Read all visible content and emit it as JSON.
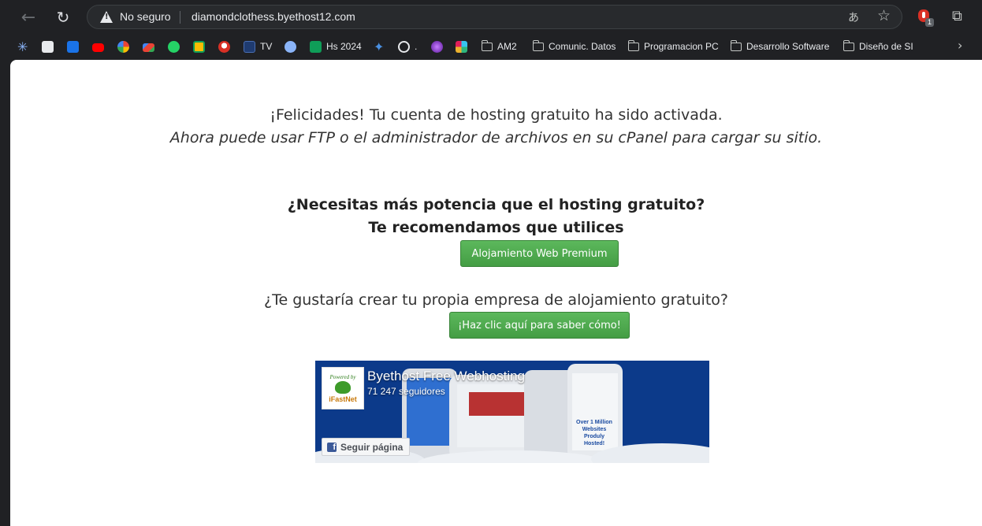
{
  "browser": {
    "security_label": "No seguro",
    "url": "diamondclothess.byethost12.com",
    "extension_badge": "1"
  },
  "bookmarks": [
    {
      "label": "",
      "icon": "asterisk-icon",
      "color": "#8ab4f8"
    },
    {
      "label": "",
      "icon": "document-icon",
      "color": "#e8eaed"
    },
    {
      "label": "",
      "icon": "google-classroom-icon",
      "color": "#1a73e8"
    },
    {
      "label": "",
      "icon": "youtube-icon",
      "color": "#ff0000"
    },
    {
      "label": "",
      "icon": "google-icon",
      "color": "#4285f4"
    },
    {
      "label": "",
      "icon": "gmail-icon",
      "color": "#ea4335"
    },
    {
      "label": "",
      "icon": "whatsapp-icon",
      "color": "#25d366"
    },
    {
      "label": "",
      "icon": "google-classroom-alt-icon",
      "color": "#fbbc04"
    },
    {
      "label": "",
      "icon": "game-icon",
      "color": "#d93025"
    },
    {
      "label": "TV",
      "icon": "tv-icon",
      "color": "#1f3b70"
    },
    {
      "label": "",
      "icon": "globe-icon",
      "color": "#8ab4f8"
    },
    {
      "label": "Hs 2024",
      "icon": "sheets-icon",
      "color": "#0f9d58"
    },
    {
      "label": "",
      "icon": "gemini-icon",
      "color": "#4a90e2"
    },
    {
      "label": ".",
      "icon": "chatgpt-icon",
      "color": "#e8eaed"
    },
    {
      "label": "",
      "icon": "orb-icon",
      "color": "#8e44ad"
    },
    {
      "label": "",
      "icon": "slack-icon",
      "color": "#e01e5a"
    },
    {
      "label": "AM2",
      "icon": "folder-icon",
      "color": "#c4c7c5"
    },
    {
      "label": "Comunic. Datos",
      "icon": "folder-icon",
      "color": "#c4c7c5"
    },
    {
      "label": "Programacion PC",
      "icon": "folder-icon",
      "color": "#c4c7c5"
    },
    {
      "label": "Desarrollo Software",
      "icon": "folder-icon",
      "color": "#c4c7c5"
    },
    {
      "label": "Diseño de SI",
      "icon": "folder-icon",
      "color": "#c4c7c5"
    }
  ],
  "page": {
    "congrats": "¡Felicidades! Tu cuenta de hosting gratuito ha sido activada.",
    "ftp_note": "Ahora puede usar FTP o el administrador de archivos en su cPanel para cargar su sitio.",
    "need_power": "¿Necesitas más potencia que el hosting gratuito?",
    "recommend": "Te recomendamos que utilices",
    "premium_button": "Alojamiento Web Premium",
    "reseller_question": "¿Te gustaría crear tu propia empresa de alojamiento gratuito?",
    "howto_button": "¡Haz clic aquí para saber cómo!"
  },
  "facebook_widget": {
    "title": "Byethost Free Webhosting",
    "followers": "71 247 seguidores",
    "follow_button": "Seguir página",
    "logo_tagline": "Powered by",
    "logo_brand": "iFastNet",
    "banner_text": "Over 1 Million Websites Produly Hosted!"
  }
}
